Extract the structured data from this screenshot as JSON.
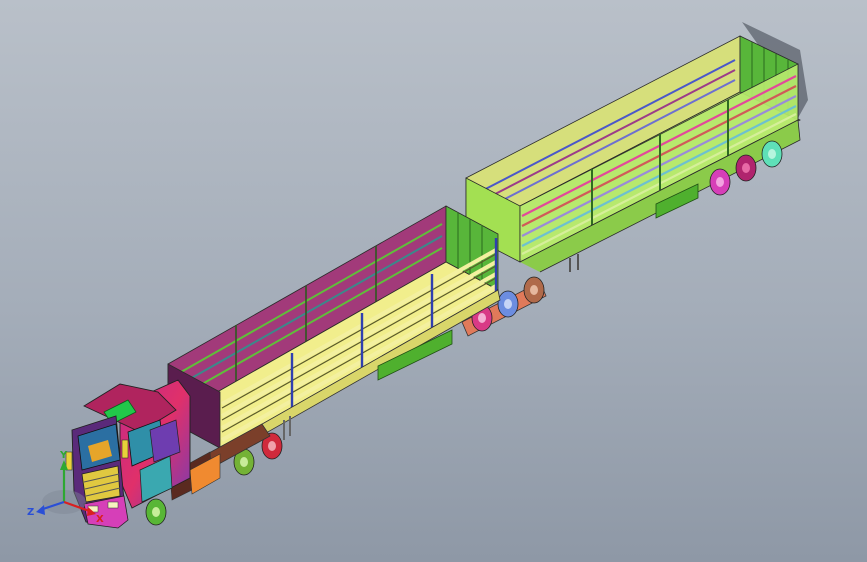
{
  "viewport": {
    "background_top": "#b9c0c9",
    "background_bottom": "#8e98a6"
  },
  "model": {
    "description_icon": "truck-trailer-3d-model",
    "front_trailer_color": "#f1ee8c",
    "rear_trailer_color": "#b7e96d",
    "side_panel_color": "#5fbf3a",
    "cab_color": "#d12c78"
  },
  "triad": {
    "labels": {
      "x": "X",
      "y": "Y",
      "z": "Z"
    },
    "colors": {
      "x": "#d92020",
      "y": "#2ea832",
      "z": "#2a4fd6"
    }
  }
}
